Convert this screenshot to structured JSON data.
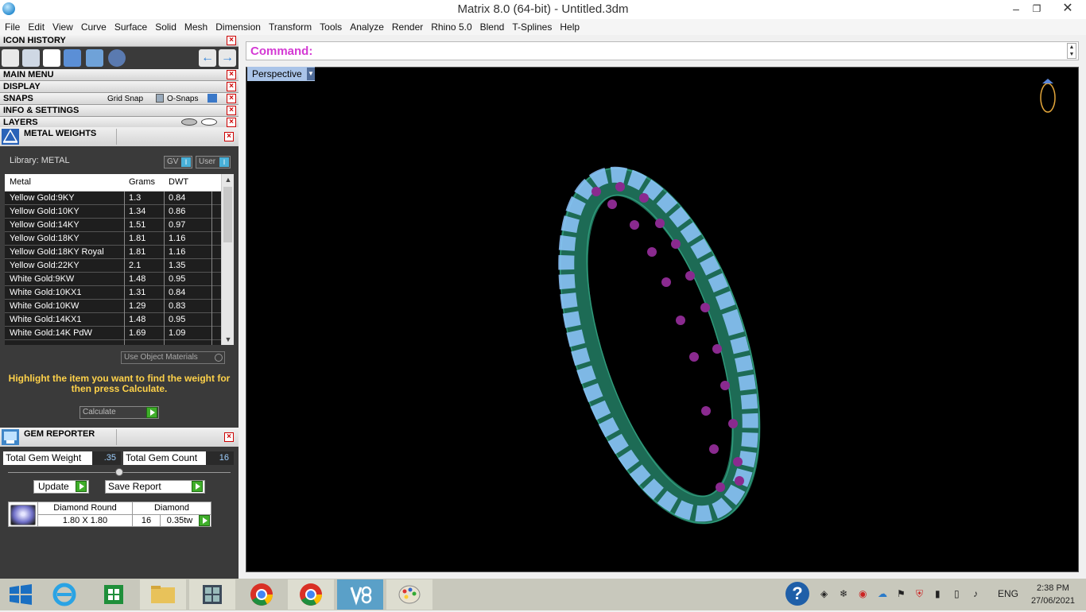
{
  "window": {
    "title": "Matrix 8.0 (64-bit) - Untitled.3dm"
  },
  "menu": [
    "File",
    "Edit",
    "View",
    "Curve",
    "Surface",
    "Solid",
    "Mesh",
    "Dimension",
    "Transform",
    "Tools",
    "Analyze",
    "Render",
    "Rhino 5.0",
    "Blend",
    "T-Splines",
    "Help"
  ],
  "panels": {
    "icon_history": "ICON HISTORY",
    "main_menu": "MAIN MENU",
    "display": "DISPLAY",
    "snaps": "SNAPS",
    "grid_snap": "Grid Snap",
    "o_snaps": "O-Snaps",
    "info_settings": "INFO & SETTINGS",
    "layers": "LAYERS"
  },
  "metal_weights": {
    "title": "METAL WEIGHTS",
    "library": "Library: METAL",
    "gv": "GV",
    "user": "User",
    "columns": [
      "Metal",
      "Grams",
      "DWT"
    ],
    "rows": [
      [
        "Yellow Gold:9KY",
        "1.3",
        "0.84"
      ],
      [
        "Yellow Gold:10KY",
        "1.34",
        "0.86"
      ],
      [
        "Yellow Gold:14KY",
        "1.51",
        "0.97"
      ],
      [
        "Yellow Gold:18KY",
        "1.81",
        "1.16"
      ],
      [
        "Yellow Gold:18KY Royal",
        "1.81",
        "1.16"
      ],
      [
        "Yellow Gold:22KY",
        "2.1",
        "1.35"
      ],
      [
        "White Gold:9KW",
        "1.48",
        "0.95"
      ],
      [
        "White Gold:10KX1",
        "1.31",
        "0.84"
      ],
      [
        "White Gold:10KW",
        "1.29",
        "0.83"
      ],
      [
        "White Gold:14KX1",
        "1.48",
        "0.95"
      ],
      [
        "White Gold:14K PdW",
        "1.69",
        "1.09"
      ]
    ],
    "use_object_materials": "Use Object Materials",
    "hint": "Highlight the item you want to find the weight for then press Calculate.",
    "calculate": "Calculate"
  },
  "gem_reporter": {
    "title": "GEM REPORTER",
    "total_weight_label": "Total Gem Weight",
    "total_weight": ".35",
    "total_count_label": "Total Gem Count",
    "total_count": "16",
    "update": "Update",
    "save_report": "Save Report",
    "gem_name": "Diamond Round",
    "gem_size": "1.80 X 1.80",
    "gem_type": "Diamond",
    "gem_count": "16",
    "gem_tw": "0.35tw"
  },
  "command": {
    "label": "Command:"
  },
  "viewport": {
    "name": "Perspective"
  },
  "taskbar": {
    "lang": "ENG",
    "time": "2:38 PM",
    "date": "27/06/2021"
  }
}
